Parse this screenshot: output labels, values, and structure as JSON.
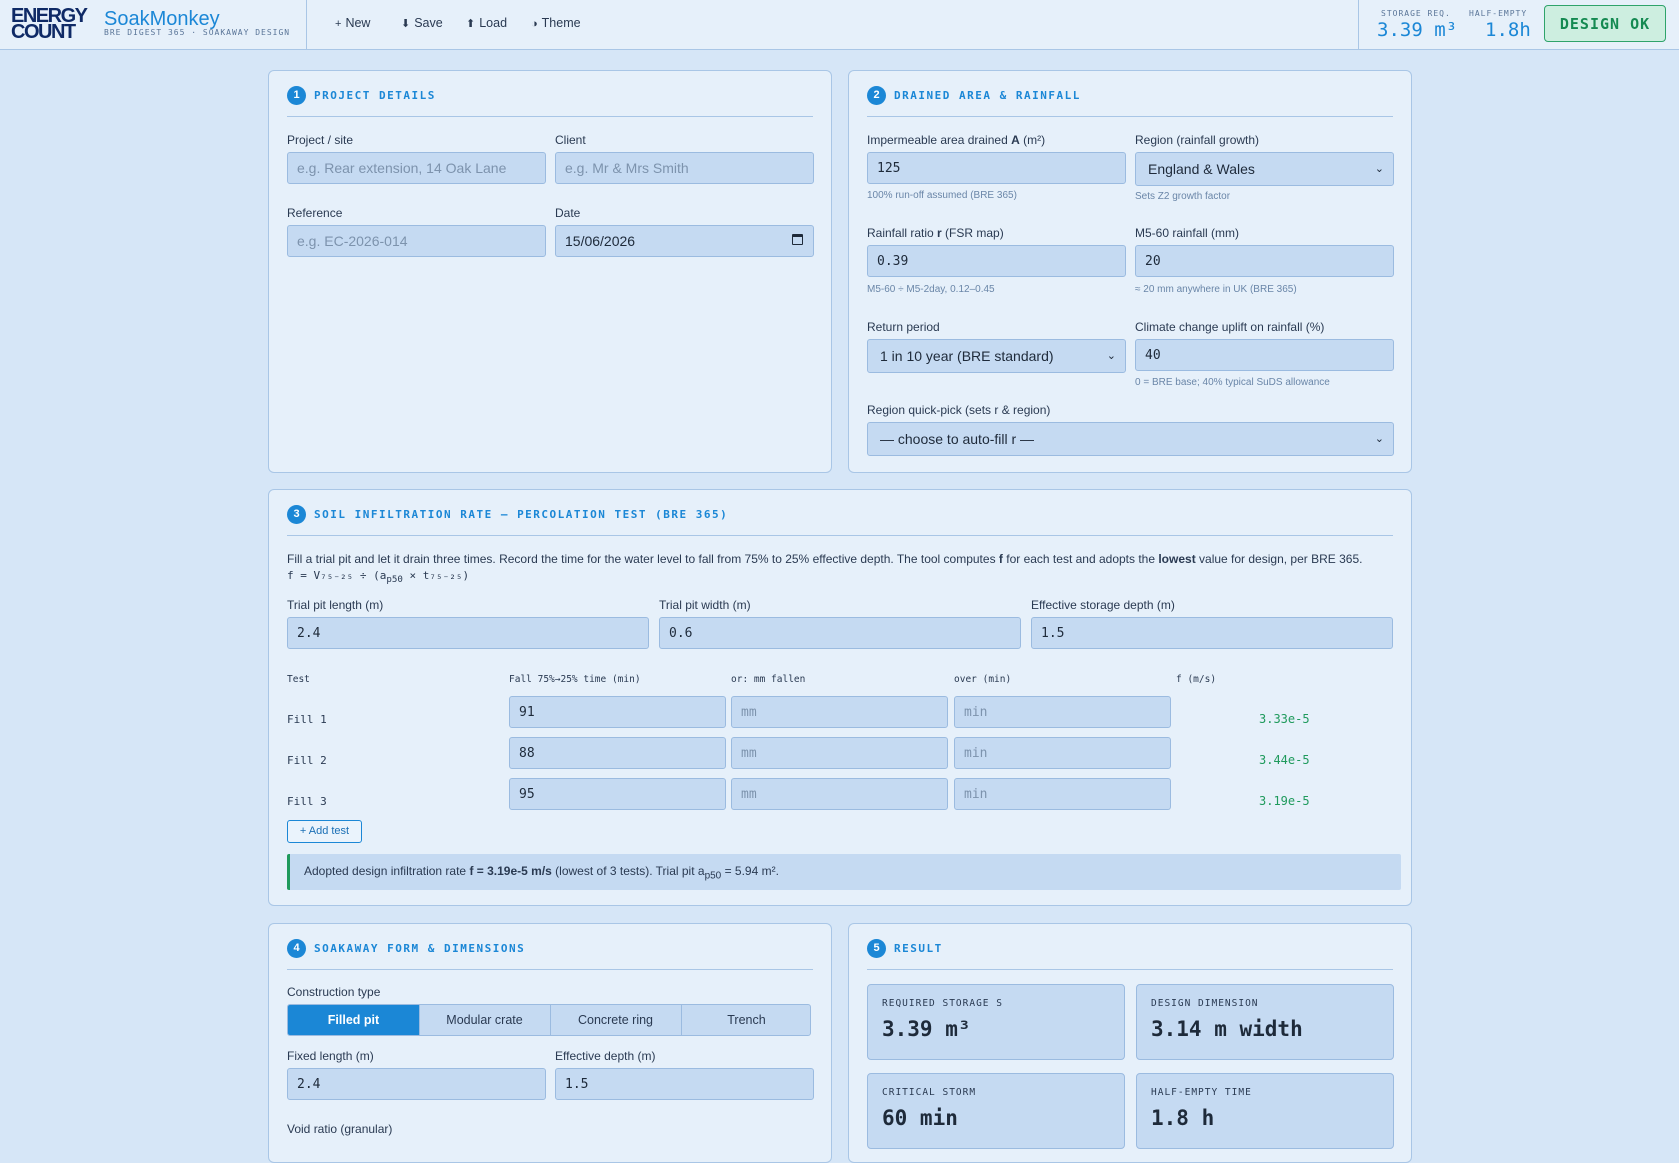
{
  "header": {
    "logo_line1": "ENERGY",
    "logo_line2": "COUNT",
    "app_name": "SoakMonkey",
    "app_subtitle": "BRE DIGEST 365 · SOAKAWAY DESIGN",
    "toolbar": [
      {
        "icon": "+",
        "label": "New"
      },
      {
        "icon": "⬇",
        "label": "Save"
      },
      {
        "icon": "⬆",
        "label": "Load"
      },
      {
        "icon": "◑",
        "label": "Theme"
      }
    ],
    "storage_label": "STORAGE REQ.",
    "storage_value": "3.39 m³",
    "half_empty_label": "HALF-EMPTY",
    "half_empty_value": "1.8h",
    "status": "DESIGN OK"
  },
  "project": {
    "num": "1",
    "title": "PROJECT DETAILS",
    "site_label": "Project / site",
    "site_placeholder": "e.g. Rear extension, 14 Oak Lane",
    "client_label": "Client",
    "client_placeholder": "e.g. Mr & Mrs Smith",
    "ref_label": "Reference",
    "ref_placeholder": "e.g. EC-2026-014",
    "date_label": "Date",
    "date_value": "15/06/2026"
  },
  "drained": {
    "num": "2",
    "title": "DRAINED AREA & RAINFALL",
    "area_label_pre": "Impermeable area drained ",
    "area_label_bold": "A",
    "area_label_post": " (m²)",
    "area_value": "125",
    "area_hint": "100% run-off assumed (BRE 365)",
    "region_label": "Region (rainfall growth)",
    "region_value": "England & Wales",
    "region_hint": "Sets Z2 growth factor",
    "ratio_label_pre": "Rainfall ratio ",
    "ratio_label_bold": "r",
    "ratio_label_post": " (FSR map)",
    "ratio_value": "0.39",
    "ratio_hint": "M5-60 ÷ M5-2day, 0.12–0.45",
    "m560_label": "M5-60 rainfall (mm)",
    "m560_value": "20",
    "m560_hint": "≈ 20 mm anywhere in UK (BRE 365)",
    "return_label": "Return period",
    "return_value": "1 in 10 year (BRE standard)",
    "climate_label": "Climate change uplift on rainfall (%)",
    "climate_value": "40",
    "climate_hint": "0 = BRE base; 40% typical SuDS allowance",
    "quickpick_label": "Region quick-pick (sets r & region)",
    "quickpick_value": "— choose to auto-fill r —"
  },
  "soil": {
    "num": "3",
    "title": "SOIL INFILTRATION RATE — PERCOLATION TEST (BRE 365)",
    "intro_pre": "Fill a trial pit and let it drain three times. Record the time for the water level to fall from 75% to 25% effective depth. The tool computes ",
    "intro_f": "f",
    "intro_mid": " for each test and adopts the ",
    "intro_lowest": "lowest",
    "intro_post": " value for design, per BRE 365.",
    "formula": "f = V₇₅₋₂₅ ÷ (a",
    "formula_sub": "p50",
    "formula_post": " × t₇₅₋₂₅)",
    "pit_length_label": "Trial pit length (m)",
    "pit_length_value": "2.4",
    "pit_width_label": "Trial pit width (m)",
    "pit_width_value": "0.6",
    "eff_depth_label": "Effective storage depth (m)",
    "eff_depth_value": "1.5",
    "columns": [
      "Test",
      "Fall 75%→25% time (min)",
      "or: mm fallen",
      "over (min)",
      "f (m/s)"
    ],
    "mm_placeholder": "mm",
    "min_placeholder": "min",
    "tests": [
      {
        "name": "Fill 1",
        "time": "91",
        "f": "3.33e-5"
      },
      {
        "name": "Fill 2",
        "time": "88",
        "f": "3.44e-5"
      },
      {
        "name": "Fill 3",
        "time": "95",
        "f": "3.19e-5"
      }
    ],
    "add_test": "+ Add test",
    "adopted_pre": "Adopted design infiltration rate ",
    "adopted_bold": "f = 3.19e-5 m/s",
    "adopted_mid": " (lowest of 3 tests). Trial pit a",
    "adopted_sub": "p50",
    "adopted_post": " = 5.94 m²."
  },
  "soakaway": {
    "num": "4",
    "title": "SOAKAWAY FORM & DIMENSIONS",
    "construction_label": "Construction type",
    "types": [
      "Filled pit",
      "Modular crate",
      "Concrete ring",
      "Trench"
    ],
    "fixed_length_label": "Fixed length (m)",
    "fixed_length_value": "2.4",
    "eff_depth_label": "Effective depth (m)",
    "eff_depth_value": "1.5",
    "void_label": "Void ratio (granular)"
  },
  "result": {
    "num": "5",
    "title": "RESULT",
    "boxes": [
      {
        "label": "REQUIRED STORAGE S",
        "value": "3.39 m³"
      },
      {
        "label": "DESIGN DIMENSION",
        "value": "3.14 m width"
      },
      {
        "label": "CRITICAL STORM",
        "value": "60 min"
      },
      {
        "label": "HALF-EMPTY TIME",
        "value": "1.8 h"
      }
    ]
  }
}
